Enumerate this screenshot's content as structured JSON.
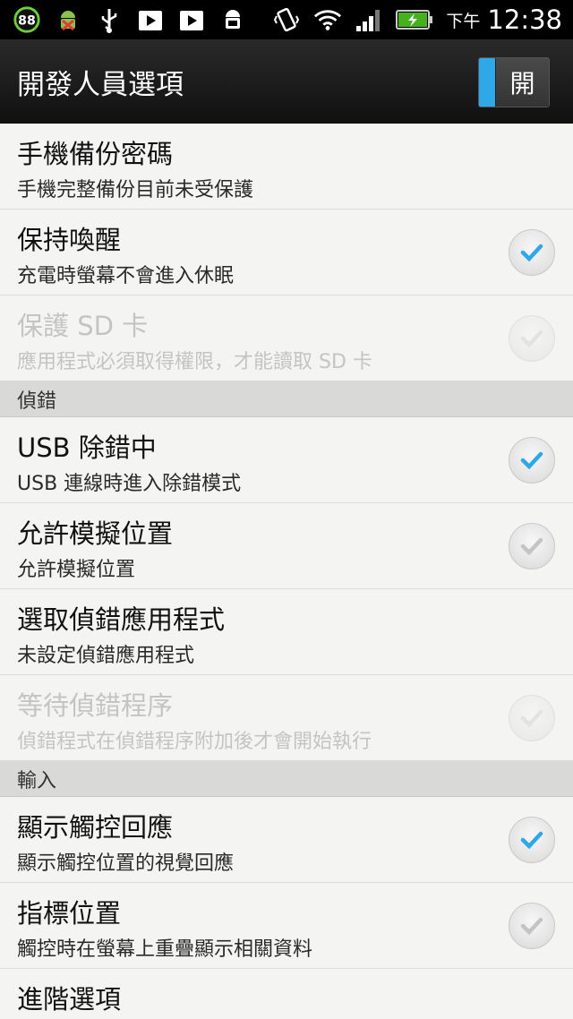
{
  "status_bar": {
    "battery_badge": "88",
    "ampm": "下午",
    "time": "12:38",
    "icons": [
      "battery-circle-icon",
      "android-debug-icon",
      "usb-icon",
      "play-store-icon",
      "play-store-icon",
      "android-debug-icon",
      "vibrate-icon",
      "wifi-icon",
      "signal-icon",
      "battery-charging-icon"
    ]
  },
  "action_bar": {
    "title": "開發人員選項",
    "toggle_label": "開",
    "accent_color": "#2ea8e8"
  },
  "rows": [
    {
      "title": "手機備份密碼",
      "summary": "手機完整備份目前未受保護",
      "enabled": true,
      "checkbox": false
    },
    {
      "title": "保持喚醒",
      "summary": "充電時螢幕不會進入休眠",
      "enabled": true,
      "checkbox": true,
      "checked": true
    },
    {
      "title": "保護 SD 卡",
      "summary": "應用程式必須取得權限，才能讀取 SD 卡",
      "enabled": false,
      "checkbox": true,
      "checked": false
    }
  ],
  "section_debug": "偵錯",
  "rows_debug": [
    {
      "title": "USB 除錯中",
      "summary": "USB 連線時進入除錯模式",
      "enabled": true,
      "checkbox": true,
      "checked": true
    },
    {
      "title": "允許模擬位置",
      "summary": "允許模擬位置",
      "enabled": true,
      "checkbox": true,
      "checked": false
    },
    {
      "title": "選取偵錯應用程式",
      "summary": "未設定偵錯應用程式",
      "enabled": true,
      "checkbox": false
    },
    {
      "title": "等待偵錯程序",
      "summary": "偵錯程式在偵錯程序附加後才會開始執行",
      "enabled": false,
      "checkbox": true,
      "checked": false
    }
  ],
  "section_input": "輸入",
  "rows_input": [
    {
      "title": "顯示觸控回應",
      "summary": "顯示觸控位置的視覺回應",
      "enabled": true,
      "checkbox": true,
      "checked": true
    },
    {
      "title": "指標位置",
      "summary": "觸控時在螢幕上重疊顯示相關資料",
      "enabled": true,
      "checkbox": true,
      "checked": false
    },
    {
      "title": "進階選項",
      "summary": "",
      "enabled": true,
      "checkbox": false
    }
  ]
}
